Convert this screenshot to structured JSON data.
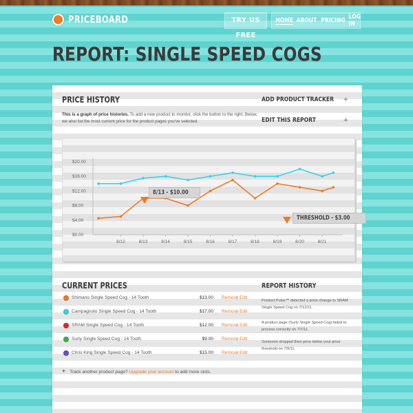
{
  "brand": {
    "name": "PRICEBOARD",
    "color": "#f37a1f"
  },
  "nav": {
    "try_label": "TRY US FREE",
    "links": [
      {
        "label": "HOME",
        "active": true
      },
      {
        "label": "ABOUT",
        "active": false
      },
      {
        "label": "PRICING",
        "active": false
      },
      {
        "label": "LOG IN",
        "active": false
      }
    ]
  },
  "page": {
    "title": "REPORT: SINGLE SPEED COGS"
  },
  "price_history": {
    "heading": "PRICE HISTORY",
    "intro_bold": "This is a graph of price histories.",
    "intro_rest": " To add a new product to monitor, click the button to the right. Below, we also list the most current price for the product pages you've selected."
  },
  "sidebar_actions": [
    {
      "label": "ADD PRODUCT TRACKER",
      "icon": "plus-icon",
      "symbol": "+"
    },
    {
      "label": "EDIT THIS REPORT",
      "icon": "plus-icon",
      "symbol": "+"
    }
  ],
  "chart_data": {
    "type": "line",
    "x": [
      "8/12",
      "8/13",
      "8/14",
      "8/15",
      "8/16",
      "8/17",
      "8/18",
      "8/19",
      "8/20",
      "8/21"
    ],
    "y_ticks": [
      "$20.00",
      "$16.00",
      "$12.00",
      "$8.00",
      "$4.00",
      "$0.00"
    ],
    "ylim": [
      0,
      20
    ],
    "series": [
      {
        "color": "#35d3e8",
        "points": [
          [
            8.11,
            14.0
          ],
          [
            8.12,
            14.0
          ],
          [
            8.13,
            15.5
          ],
          [
            8.14,
            16.0
          ],
          [
            8.15,
            15.0
          ],
          [
            8.16,
            16.0
          ],
          [
            8.17,
            17.0
          ],
          [
            8.18,
            16.0
          ],
          [
            8.19,
            16.0
          ],
          [
            8.2,
            18.0
          ],
          [
            8.21,
            16.0
          ],
          [
            8.215,
            17.0
          ]
        ]
      },
      {
        "color": "#f07a22",
        "points": [
          [
            8.11,
            4.5
          ],
          [
            8.12,
            5.0
          ],
          [
            8.13,
            10.0
          ],
          [
            8.14,
            10.0
          ],
          [
            8.15,
            8.0
          ],
          [
            8.16,
            12.0
          ],
          [
            8.17,
            15.0
          ],
          [
            8.18,
            10.0
          ],
          [
            8.19,
            14.0
          ],
          [
            8.2,
            13.0
          ],
          [
            8.21,
            12.0
          ],
          [
            8.215,
            13.0
          ]
        ]
      }
    ],
    "annotations": [
      {
        "label": "8/13 - $10.00",
        "x": "8/13",
        "y": 10.0
      },
      {
        "label": "THRESHOLD - $3.00",
        "y": 3.0
      }
    ],
    "grid": false
  },
  "current_prices": {
    "heading": "CURRENT PRICES",
    "remove_label": "Remove",
    "edit_label": "Edit",
    "sep": "|",
    "items": [
      {
        "name": "Shimano Single Speed Cog - 14 Tooth",
        "price": "$13.00",
        "color": "#f07a22"
      },
      {
        "name": "Campagnolo Single Speed Cog - 14 Tooth",
        "price": "$17.00",
        "color": "#35d3e8"
      },
      {
        "name": "SRAM Single Speed Cog - 14 Tooth",
        "price": "$12.00",
        "color": "#e0282a"
      },
      {
        "name": "Surly Single Speed Cog - 14 Tooth",
        "price": "$9.00",
        "color": "#37b54a"
      },
      {
        "name": "Chris King Single Speed Cog - 14 Tooth",
        "price": "$15.00",
        "color": "#6a4fc9"
      }
    ],
    "track": {
      "symbol": "+",
      "prefix": "Track another product page? ",
      "link": "Upgrade your account",
      "suffix": " to add more slots."
    }
  },
  "report_history": {
    "heading": "REPORT HISTORY",
    "entries": [
      "Product Pulse™ detected a price change to SRAM Single Speed Cog on 7/12/11.",
      "A product page (Surly Single Speed Cog) failed to process correctly on 7/7/11.",
      "Someone dropped their price below your price threshold on 7/9/11."
    ]
  }
}
